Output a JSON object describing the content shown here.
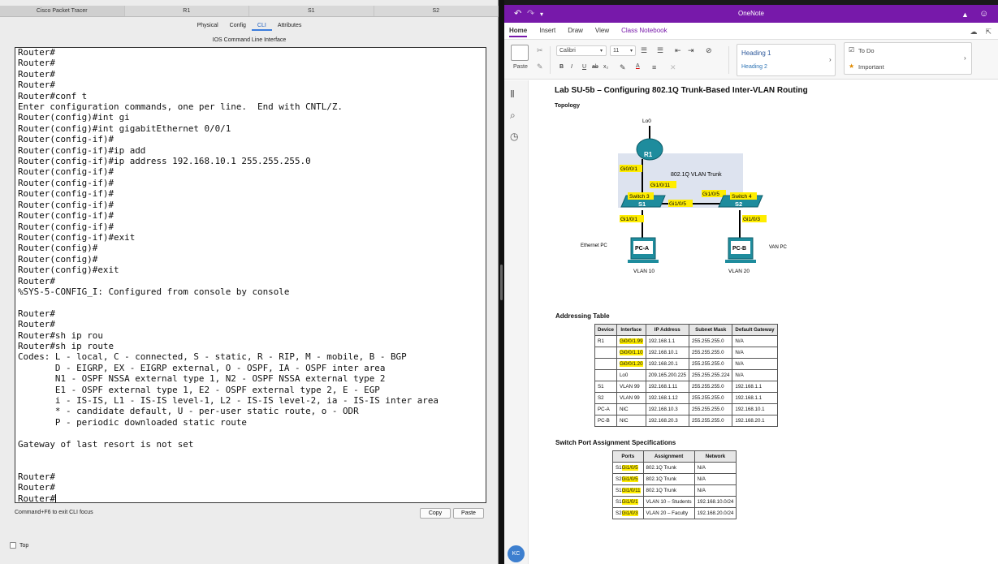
{
  "packet_tracer": {
    "tabs": [
      "Cisco Packet Tracer",
      "R1",
      "S1",
      "S2"
    ],
    "subtabs": [
      "Physical",
      "Config",
      "CLI",
      "Attributes"
    ],
    "active_subtab": "CLI",
    "ios_title": "IOS Command Line Interface",
    "cli_lines": [
      "Router#",
      "Router#",
      "Router#",
      "Router#",
      "Router#conf t",
      "Enter configuration commands, one per line.  End with CNTL/Z.",
      "Router(config)#int gi",
      "Router(config)#int gigabitEthernet 0/0/1",
      "Router(config-if)#",
      "Router(config-if)#ip add",
      "Router(config-if)#ip address 192.168.10.1 255.255.255.0",
      "Router(config-if)#",
      "Router(config-if)#",
      "Router(config-if)#",
      "Router(config-if)#",
      "Router(config-if)#",
      "Router(config-if)#",
      "Router(config-if)#exit",
      "Router(config)#",
      "Router(config)#",
      "Router(config)#exit",
      "Router#",
      "%SYS-5-CONFIG_I: Configured from console by console",
      "",
      "Router#",
      "Router#",
      "Router#sh ip rou",
      "Router#sh ip route",
      "Codes: L - local, C - connected, S - static, R - RIP, M - mobile, B - BGP",
      "       D - EIGRP, EX - EIGRP external, O - OSPF, IA - OSPF inter area",
      "       N1 - OSPF NSSA external type 1, N2 - OSPF NSSA external type 2",
      "       E1 - OSPF external type 1, E2 - OSPF external type 2, E - EGP",
      "       i - IS-IS, L1 - IS-IS level-1, L2 - IS-IS level-2, ia - IS-IS inter area",
      "       * - candidate default, U - per-user static route, o - ODR",
      "       P - periodic downloaded static route",
      "",
      "Gateway of last resort is not set",
      "",
      "",
      "Router#",
      "Router#",
      "Router#"
    ],
    "footer_hint": "Command+F6 to exit CLI focus",
    "copy_label": "Copy",
    "paste_label": "Paste",
    "top_label": "Top"
  },
  "onenote": {
    "title": "OneNote",
    "ribbon_tabs": [
      "Home",
      "Insert",
      "Draw",
      "View",
      "Class Notebook"
    ],
    "active_tab": "Home",
    "ribbon": {
      "paste_label": "Paste",
      "font_name": "Calibri",
      "font_size": "11",
      "heading1": "Heading 1",
      "heading2": "Heading 2",
      "todo": "To Do",
      "important": "Important"
    },
    "avatar_initials": "KC",
    "brand_color": "#7719aa",
    "page": {
      "title": "Lab SU-5b – Configuring 802.1Q Trunk-Based Inter-VLAN Routing",
      "topology_label": "Topology",
      "topology": {
        "lo0": "Lo0",
        "r1": "R1",
        "r1_port": "Gi0/0/1",
        "trunk_label": "802.1Q  VLAN Trunk",
        "s1_trunk_port": "Gi1/0/11",
        "s2_trunk_port": "Gi1/0/5",
        "s1_link_port": "Gi1/0/5",
        "switch3": "Switch 3",
        "switch4": "Switch 4",
        "s1": "S1",
        "s2": "S2",
        "s1_pc_port": "Gi1/0/1",
        "s2_pc_port": "Gi1/0/3",
        "pc_a": "PC-A",
        "pc_b": "PC-B",
        "ethernet_pc": "Ethernet PC",
        "van_pc": "VAN PC",
        "vlan10": "VLAN 10",
        "vlan20": "VLAN 20"
      },
      "addressing_title": "Addressing Table",
      "addressing_headers": [
        "Device",
        "Interface",
        "IP Address",
        "Subnet Mask",
        "Default Gateway"
      ],
      "addressing_rows": [
        [
          "R1",
          "Gi0/0/1.99",
          "192.168.1.1",
          "255.255.255.0",
          "N/A"
        ],
        [
          "",
          "Gi0/0/1.10",
          "192.168.10.1",
          "255.255.255.0",
          "N/A"
        ],
        [
          "",
          "Gi0/0/1.20",
          "192.168.20.1",
          "255.255.255.0",
          "N/A"
        ],
        [
          "",
          "Lo0",
          "209.165.200.225",
          "255.255.255.224",
          "N/A"
        ],
        [
          "S1",
          "VLAN 99",
          "192.168.1.11",
          "255.255.255.0",
          "192.168.1.1"
        ],
        [
          "S2",
          "VLAN 99",
          "192.168.1.12",
          "255.255.255.0",
          "192.168.1.1"
        ],
        [
          "PC-A",
          "NIC",
          "192.168.10.3",
          "255.255.255.0",
          "192.168.10.1"
        ],
        [
          "PC-B",
          "NIC",
          "192.168.20.3",
          "255.255.255.0",
          "192.168.20.1"
        ]
      ],
      "addressing_highlight_rows": [
        0,
        1,
        2
      ],
      "switch_title": "Switch Port Assignment Specifications",
      "switch_headers": [
        "Ports",
        "Assignment",
        "Network"
      ],
      "switch_rows": [
        [
          "S1",
          "Gi1/0/5",
          "802.1Q Trunk",
          "N/A"
        ],
        [
          "S2",
          "Gi1/0/5",
          "802.1Q Trunk",
          "N/A"
        ],
        [
          "S1",
          "Gi1/0/11",
          "802.1Q Trunk",
          "N/A"
        ],
        [
          "S1",
          "Gi1/0/1",
          "VLAN 10 – Students",
          "192.168.10.0/24"
        ],
        [
          "S2",
          "Gi1/0/3",
          "VLAN 20 – Faculty",
          "192.168.20.0/24"
        ]
      ]
    }
  }
}
